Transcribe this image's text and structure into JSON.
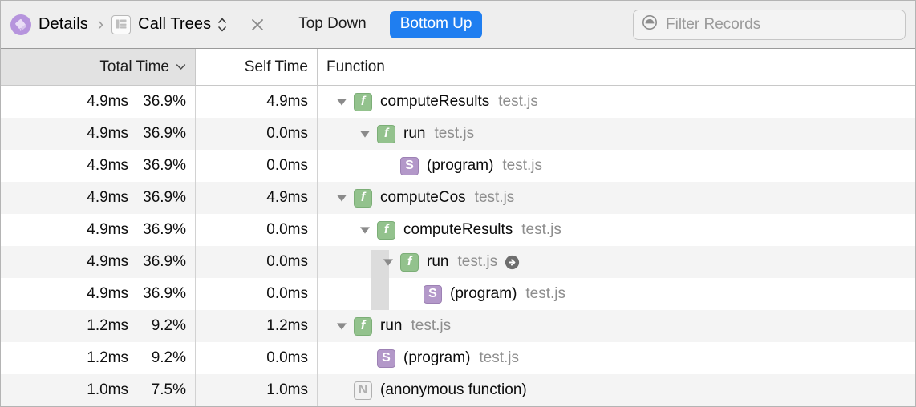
{
  "toolbar": {
    "details_icon": "details-document-icon",
    "breadcrumb_root": "Details",
    "breadcrumb_separator": "›",
    "calltrees_icon": "call-trees-list-icon",
    "breadcrumb_current": "Call Trees",
    "stepper_icon": "chevron-up-down-icon",
    "close_icon": "close-icon",
    "top_down_label": "Top Down",
    "bottom_up_label": "Bottom Up",
    "active_segment": "Bottom Up",
    "filter_icon": "filter-records-icon",
    "filter_placeholder": "Filter Records",
    "filter_value": "",
    "accent_color": "#1f7ef0",
    "toolbar_bg": "#eeeeee"
  },
  "table": {
    "columns": [
      {
        "id": "total",
        "label": "Total Time",
        "sorted": true,
        "sort_icon": "chevron-down-icon"
      },
      {
        "id": "self",
        "label": "Self Time",
        "sorted": false,
        "sort_icon": ""
      },
      {
        "id": "func",
        "label": "Function",
        "sorted": false,
        "sort_icon": ""
      }
    ],
    "rows": [
      {
        "total_ms": "4.9ms",
        "total_pct": "36.9%",
        "self_ms": "4.9ms",
        "depth": 0,
        "twisty": "down",
        "kind": "f",
        "kind_glyph": "f",
        "name": "computeResults",
        "source": "test.js",
        "goto": false
      },
      {
        "total_ms": "4.9ms",
        "total_pct": "36.9%",
        "self_ms": "0.0ms",
        "depth": 1,
        "twisty": "down",
        "kind": "f",
        "kind_glyph": "f",
        "name": "run",
        "source": "test.js",
        "goto": false
      },
      {
        "total_ms": "4.9ms",
        "total_pct": "36.9%",
        "self_ms": "0.0ms",
        "depth": 2,
        "twisty": "none",
        "kind": "s",
        "kind_glyph": "S",
        "name": "(program)",
        "source": "test.js",
        "goto": false
      },
      {
        "total_ms": "4.9ms",
        "total_pct": "36.9%",
        "self_ms": "4.9ms",
        "depth": 0,
        "twisty": "down",
        "kind": "f",
        "kind_glyph": "f",
        "name": "computeCos",
        "source": "test.js",
        "goto": false
      },
      {
        "total_ms": "4.9ms",
        "total_pct": "36.9%",
        "self_ms": "0.0ms",
        "depth": 1,
        "twisty": "down",
        "kind": "f",
        "kind_glyph": "f",
        "name": "computeResults",
        "source": "test.js",
        "goto": false
      },
      {
        "total_ms": "4.9ms",
        "total_pct": "36.9%",
        "self_ms": "0.0ms",
        "depth": 2,
        "twisty": "down",
        "kind": "f",
        "kind_glyph": "f",
        "name": "run",
        "source": "test.js",
        "goto": true
      },
      {
        "total_ms": "4.9ms",
        "total_pct": "36.9%",
        "self_ms": "0.0ms",
        "depth": 3,
        "twisty": "none",
        "kind": "s",
        "kind_glyph": "S",
        "name": "(program)",
        "source": "test.js",
        "goto": false
      },
      {
        "total_ms": "1.2ms",
        "total_pct": "9.2%",
        "self_ms": "1.2ms",
        "depth": 0,
        "twisty": "down",
        "kind": "f",
        "kind_glyph": "f",
        "name": "run",
        "source": "test.js",
        "goto": false
      },
      {
        "total_ms": "1.2ms",
        "total_pct": "9.2%",
        "self_ms": "0.0ms",
        "depth": 1,
        "twisty": "none",
        "kind": "s",
        "kind_glyph": "S",
        "name": "(program)",
        "source": "test.js",
        "goto": false
      },
      {
        "total_ms": "1.0ms",
        "total_pct": "7.5%",
        "self_ms": "1.0ms",
        "depth": 0,
        "twisty": "none",
        "kind": "n",
        "kind_glyph": "N",
        "name": "(anonymous function)",
        "source": "",
        "goto": false
      }
    ]
  }
}
